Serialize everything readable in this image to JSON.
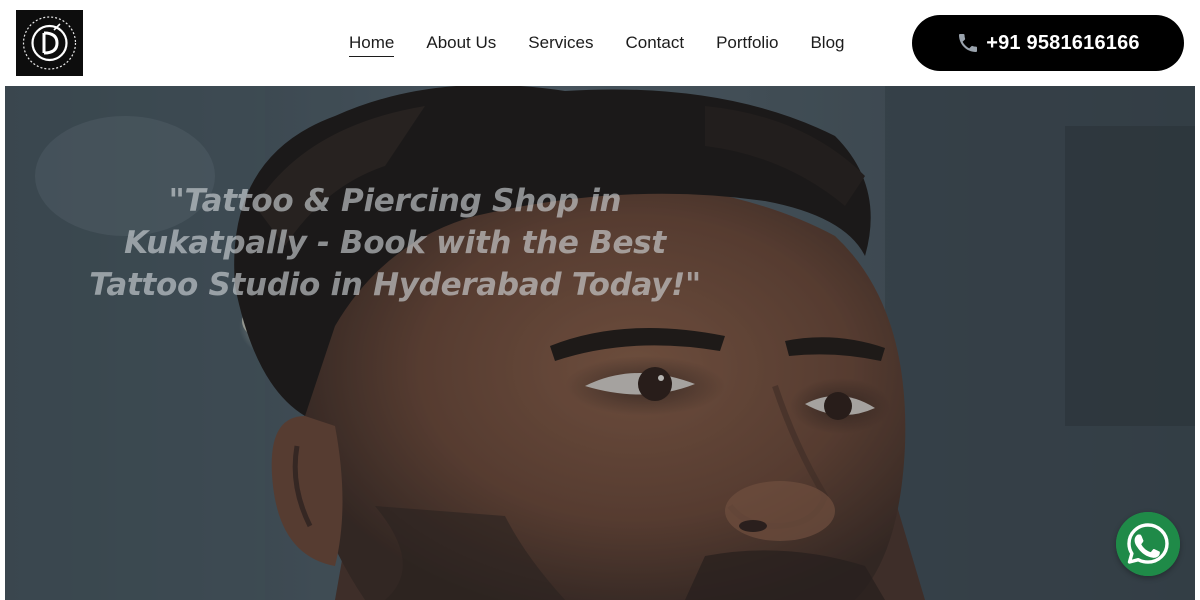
{
  "header": {
    "logo_alt": "Tattoo studio logo",
    "nav": [
      {
        "label": "Home"
      },
      {
        "label": "About Us"
      },
      {
        "label": "Services"
      },
      {
        "label": "Contact"
      },
      {
        "label": "Portfolio"
      },
      {
        "label": "Blog"
      }
    ],
    "call_button": {
      "label": "+91 9581616166",
      "icon": "phone-icon"
    }
  },
  "hero": {
    "headline": "\"Tattoo & Piercing Shop in Kukatpally - Book with the Best Tattoo Studio in Hyderabad Today!\""
  },
  "floating": {
    "whatsapp_icon": "whatsapp-icon"
  },
  "colors": {
    "accent": "#000000",
    "whatsapp": "#1f8a48",
    "text": "#1c1c1c"
  }
}
